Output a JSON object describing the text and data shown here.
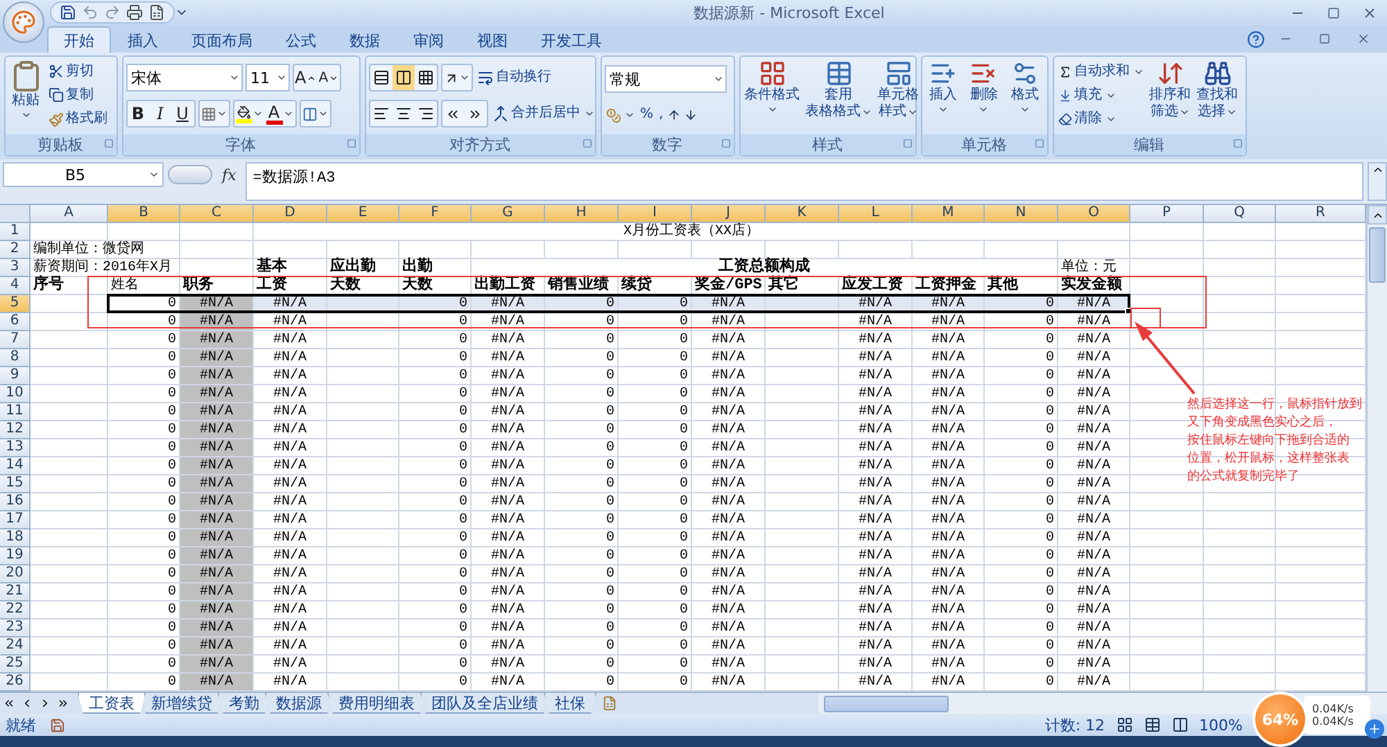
{
  "window": {
    "title": "数据源新 - Microsoft Excel"
  },
  "ribbon_tabs": [
    {
      "label": "开始",
      "selected": true
    },
    {
      "label": "插入",
      "selected": false
    },
    {
      "label": "页面布局",
      "selected": false
    },
    {
      "label": "公式",
      "selected": false
    },
    {
      "label": "数据",
      "selected": false
    },
    {
      "label": "审阅",
      "selected": false
    },
    {
      "label": "视图",
      "selected": false
    },
    {
      "label": "开发工具",
      "selected": false
    }
  ],
  "ribbon": {
    "clipboard": {
      "label": "剪贴板",
      "paste": "粘贴",
      "cut": "剪切",
      "copy": "复制",
      "format_painter": "格式刷"
    },
    "font": {
      "label": "字体",
      "font_name": "宋体",
      "font_size": "11",
      "grow": "A",
      "shrink": "A",
      "bold": "B",
      "italic": "I",
      "underline": "U",
      "font_color": "A"
    },
    "alignment": {
      "label": "对齐方式",
      "vertical": [
        {
          "selected": false
        },
        {
          "selected": true
        },
        {
          "selected": false
        }
      ],
      "wrap_text": "自动换行",
      "merge_center": "合并后居中"
    },
    "number": {
      "label": "数字",
      "format": "常规",
      "percent": "%",
      "comma": ","
    },
    "styles": {
      "label": "样式",
      "buttons": [
        {
          "lines": [
            "条件格式"
          ]
        },
        {
          "lines": [
            "套用",
            "表格格式"
          ]
        },
        {
          "lines": [
            "单元格",
            "样式"
          ]
        }
      ]
    },
    "cells": {
      "label": "单元格",
      "buttons": [
        {
          "lines": [
            "插入"
          ]
        },
        {
          "lines": [
            "删除"
          ]
        },
        {
          "lines": [
            "格式"
          ]
        }
      ]
    },
    "editing": {
      "label": "编辑",
      "autosum": "自动求和",
      "fill": "填充",
      "clear": "清除",
      "sort_filter": [
        "排序和",
        "筛选"
      ],
      "find_select": [
        "查找和",
        "选择"
      ]
    }
  },
  "formula_bar": {
    "name_box": "B5",
    "fx": "fx",
    "formula": "=数据源!A3"
  },
  "columns": [
    {
      "label": "A",
      "selected": false
    },
    {
      "label": "B",
      "selected": true
    },
    {
      "label": "C",
      "selected": true
    },
    {
      "label": "D",
      "selected": true
    },
    {
      "label": "E",
      "selected": true
    },
    {
      "label": "F",
      "selected": true
    },
    {
      "label": "G",
      "selected": true
    },
    {
      "label": "H",
      "selected": true
    },
    {
      "label": "I",
      "selected": true
    },
    {
      "label": "J",
      "selected": true
    },
    {
      "label": "K",
      "selected": true
    },
    {
      "label": "L",
      "selected": true
    },
    {
      "label": "M",
      "selected": true
    },
    {
      "label": "N",
      "selected": true
    },
    {
      "label": "O",
      "selected": true
    },
    {
      "label": "P",
      "selected": false
    },
    {
      "label": "Q",
      "selected": false
    },
    {
      "label": "R",
      "selected": false
    }
  ],
  "rows": [
    {
      "number": "1",
      "selected": false,
      "cells": {
        "D": {
          "text": "X月份工资表（XX店）",
          "kind": "title"
        }
      }
    },
    {
      "number": "2",
      "selected": false,
      "cells": {
        "A": {
          "text": "编制单位：微贷网",
          "kind": "text"
        }
      }
    },
    {
      "number": "3",
      "selected": false,
      "cells": {
        "A": {
          "text": "薪资期间：2016年X月",
          "kind": "text"
        },
        "D": {
          "text": "基本",
          "kind": "heading"
        },
        "E": {
          "text": "应出勤",
          "kind": "heading"
        },
        "F": {
          "text": "出勤",
          "kind": "heading"
        },
        "G": {
          "text": "工资总额构成",
          "kind": "group"
        },
        "O": {
          "text": "单位：元",
          "kind": "text"
        }
      }
    },
    {
      "number": "4",
      "selected": false,
      "cells": {
        "A": {
          "text": "序号",
          "kind": "heading"
        },
        "B": {
          "text": "姓名",
          "kind": "text"
        },
        "C": {
          "text": "职务",
          "kind": "heading"
        },
        "D": {
          "text": "工资",
          "kind": "heading"
        },
        "E": {
          "text": "天数",
          "kind": "heading"
        },
        "F": {
          "text": "天数",
          "kind": "heading"
        },
        "G": {
          "text": "出勤工资",
          "kind": "heading"
        },
        "H": {
          "text": "销售业绩",
          "kind": "heading"
        },
        "I": {
          "text": "续贷",
          "kind": "heading"
        },
        "J": {
          "text": "奖金/GPS",
          "kind": "heading"
        },
        "K": {
          "text": "其它",
          "kind": "heading"
        },
        "L": {
          "text": "应发工资",
          "kind": "heading"
        },
        "M": {
          "text": "工资押金",
          "kind": "heading"
        },
        "N": {
          "text": "其他",
          "kind": "heading"
        },
        "O": {
          "text": "实发金额",
          "kind": "heading"
        }
      }
    },
    {
      "number": "5",
      "selected": true,
      "cells": {
        "B": {
          "text": "0",
          "kind": "number"
        },
        "C": {
          "text": "#N/A",
          "kind": "error",
          "shaded": true
        },
        "D": {
          "text": "#N/A",
          "kind": "error"
        },
        "F": {
          "text": "0",
          "kind": "number"
        },
        "G": {
          "text": "#N/A",
          "kind": "error"
        },
        "H": {
          "text": "0",
          "kind": "number"
        },
        "I": {
          "text": "0",
          "kind": "number"
        },
        "J": {
          "text": "#N/A",
          "kind": "error"
        },
        "L": {
          "text": "#N/A",
          "kind": "error"
        },
        "M": {
          "text": "#N/A",
          "kind": "error"
        },
        "N": {
          "text": "0",
          "kind": "number"
        },
        "O": {
          "text": "#N/A",
          "kind": "error"
        }
      }
    },
    {
      "number": "6",
      "selected": false,
      "cells": {
        "B": {
          "text": "0",
          "kind": "number"
        },
        "C": {
          "text": "#N/A",
          "kind": "error",
          "shaded": true
        },
        "D": {
          "text": "#N/A",
          "kind": "error"
        },
        "F": {
          "text": "0",
          "kind": "number"
        },
        "G": {
          "text": "#N/A",
          "kind": "error"
        },
        "H": {
          "text": "0",
          "kind": "number"
        },
        "I": {
          "text": "0",
          "kind": "number"
        },
        "J": {
          "text": "#N/A",
          "kind": "error"
        },
        "L": {
          "text": "#N/A",
          "kind": "error"
        },
        "M": {
          "text": "#N/A",
          "kind": "error"
        },
        "N": {
          "text": "0",
          "kind": "number"
        },
        "O": {
          "text": "#N/A",
          "kind": "error"
        }
      }
    },
    {
      "number": "7",
      "selected": false,
      "cells": {
        "B": {
          "text": "0",
          "kind": "number"
        },
        "C": {
          "text": "#N/A",
          "kind": "error",
          "shaded": true
        },
        "D": {
          "text": "#N/A",
          "kind": "error"
        },
        "F": {
          "text": "0",
          "kind": "number"
        },
        "G": {
          "text": "#N/A",
          "kind": "error"
        },
        "H": {
          "text": "0",
          "kind": "number"
        },
        "I": {
          "text": "0",
          "kind": "number"
        },
        "J": {
          "text": "#N/A",
          "kind": "error"
        },
        "L": {
          "text": "#N/A",
          "kind": "error"
        },
        "M": {
          "text": "#N/A",
          "kind": "error"
        },
        "N": {
          "text": "0",
          "kind": "number"
        },
        "O": {
          "text": "#N/A",
          "kind": "error"
        }
      }
    },
    {
      "number": "8",
      "selected": false,
      "cells": {
        "B": {
          "text": "0",
          "kind": "number"
        },
        "C": {
          "text": "#N/A",
          "kind": "error",
          "shaded": true
        },
        "D": {
          "text": "#N/A",
          "kind": "error"
        },
        "F": {
          "text": "0",
          "kind": "number"
        },
        "G": {
          "text": "#N/A",
          "kind": "error"
        },
        "H": {
          "text": "0",
          "kind": "number"
        },
        "I": {
          "text": "0",
          "kind": "number"
        },
        "J": {
          "text": "#N/A",
          "kind": "error"
        },
        "L": {
          "text": "#N/A",
          "kind": "error"
        },
        "M": {
          "text": "#N/A",
          "kind": "error"
        },
        "N": {
          "text": "0",
          "kind": "number"
        },
        "O": {
          "text": "#N/A",
          "kind": "error"
        }
      }
    },
    {
      "number": "9",
      "selected": false,
      "cells": {
        "B": {
          "text": "0",
          "kind": "number"
        },
        "C": {
          "text": "#N/A",
          "kind": "error",
          "shaded": true
        },
        "D": {
          "text": "#N/A",
          "kind": "error"
        },
        "F": {
          "text": "0",
          "kind": "number"
        },
        "G": {
          "text": "#N/A",
          "kind": "error"
        },
        "H": {
          "text": "0",
          "kind": "number"
        },
        "I": {
          "text": "0",
          "kind": "number"
        },
        "J": {
          "text": "#N/A",
          "kind": "error"
        },
        "L": {
          "text": "#N/A",
          "kind": "error"
        },
        "M": {
          "text": "#N/A",
          "kind": "error"
        },
        "N": {
          "text": "0",
          "kind": "number"
        },
        "O": {
          "text": "#N/A",
          "kind": "error"
        }
      }
    },
    {
      "number": "10",
      "selected": false,
      "cells": {
        "B": {
          "text": "0",
          "kind": "number"
        },
        "C": {
          "text": "#N/A",
          "kind": "error",
          "shaded": true
        },
        "D": {
          "text": "#N/A",
          "kind": "error"
        },
        "F": {
          "text": "0",
          "kind": "number"
        },
        "G": {
          "text": "#N/A",
          "kind": "error"
        },
        "H": {
          "text": "0",
          "kind": "number"
        },
        "I": {
          "text": "0",
          "kind": "number"
        },
        "J": {
          "text": "#N/A",
          "kind": "error"
        },
        "L": {
          "text": "#N/A",
          "kind": "error"
        },
        "M": {
          "text": "#N/A",
          "kind": "error"
        },
        "N": {
          "text": "0",
          "kind": "number"
        },
        "O": {
          "text": "#N/A",
          "kind": "error"
        }
      }
    },
    {
      "number": "11",
      "selected": false,
      "cells": {
        "B": {
          "text": "0",
          "kind": "number"
        },
        "C": {
          "text": "#N/A",
          "kind": "error",
          "shaded": true
        },
        "D": {
          "text": "#N/A",
          "kind": "error"
        },
        "F": {
          "text": "0",
          "kind": "number"
        },
        "G": {
          "text": "#N/A",
          "kind": "error"
        },
        "H": {
          "text": "0",
          "kind": "number"
        },
        "I": {
          "text": "0",
          "kind": "number"
        },
        "J": {
          "text": "#N/A",
          "kind": "error"
        },
        "L": {
          "text": "#N/A",
          "kind": "error"
        },
        "M": {
          "text": "#N/A",
          "kind": "error"
        },
        "N": {
          "text": "0",
          "kind": "number"
        },
        "O": {
          "text": "#N/A",
          "kind": "error"
        }
      }
    },
    {
      "number": "12",
      "selected": false,
      "cells": {
        "B": {
          "text": "0",
          "kind": "number"
        },
        "C": {
          "text": "#N/A",
          "kind": "error",
          "shaded": true
        },
        "D": {
          "text": "#N/A",
          "kind": "error"
        },
        "F": {
          "text": "0",
          "kind": "number"
        },
        "G": {
          "text": "#N/A",
          "kind": "error"
        },
        "H": {
          "text": "0",
          "kind": "number"
        },
        "I": {
          "text": "0",
          "kind": "number"
        },
        "J": {
          "text": "#N/A",
          "kind": "error"
        },
        "L": {
          "text": "#N/A",
          "kind": "error"
        },
        "M": {
          "text": "#N/A",
          "kind": "error"
        },
        "N": {
          "text": "0",
          "kind": "number"
        },
        "O": {
          "text": "#N/A",
          "kind": "error"
        }
      }
    },
    {
      "number": "13",
      "selected": false,
      "cells": {
        "B": {
          "text": "0",
          "kind": "number"
        },
        "C": {
          "text": "#N/A",
          "kind": "error",
          "shaded": true
        },
        "D": {
          "text": "#N/A",
          "kind": "error"
        },
        "F": {
          "text": "0",
          "kind": "number"
        },
        "G": {
          "text": "#N/A",
          "kind": "error"
        },
        "H": {
          "text": "0",
          "kind": "number"
        },
        "I": {
          "text": "0",
          "kind": "number"
        },
        "J": {
          "text": "#N/A",
          "kind": "error"
        },
        "L": {
          "text": "#N/A",
          "kind": "error"
        },
        "M": {
          "text": "#N/A",
          "kind": "error"
        },
        "N": {
          "text": "0",
          "kind": "number"
        },
        "O": {
          "text": "#N/A",
          "kind": "error"
        }
      }
    },
    {
      "number": "14",
      "selected": false,
      "cells": {
        "B": {
          "text": "0",
          "kind": "number"
        },
        "C": {
          "text": "#N/A",
          "kind": "error",
          "shaded": true
        },
        "D": {
          "text": "#N/A",
          "kind": "error"
        },
        "F": {
          "text": "0",
          "kind": "number"
        },
        "G": {
          "text": "#N/A",
          "kind": "error"
        },
        "H": {
          "text": "0",
          "kind": "number"
        },
        "I": {
          "text": "0",
          "kind": "number"
        },
        "J": {
          "text": "#N/A",
          "kind": "error"
        },
        "L": {
          "text": "#N/A",
          "kind": "error"
        },
        "M": {
          "text": "#N/A",
          "kind": "error"
        },
        "N": {
          "text": "0",
          "kind": "number"
        },
        "O": {
          "text": "#N/A",
          "kind": "error"
        }
      }
    },
    {
      "number": "15",
      "selected": false,
      "cells": {
        "B": {
          "text": "0",
          "kind": "number"
        },
        "C": {
          "text": "#N/A",
          "kind": "error",
          "shaded": true
        },
        "D": {
          "text": "#N/A",
          "kind": "error"
        },
        "F": {
          "text": "0",
          "kind": "number"
        },
        "G": {
          "text": "#N/A",
          "kind": "error"
        },
        "H": {
          "text": "0",
          "kind": "number"
        },
        "I": {
          "text": "0",
          "kind": "number"
        },
        "J": {
          "text": "#N/A",
          "kind": "error"
        },
        "L": {
          "text": "#N/A",
          "kind": "error"
        },
        "M": {
          "text": "#N/A",
          "kind": "error"
        },
        "N": {
          "text": "0",
          "kind": "number"
        },
        "O": {
          "text": "#N/A",
          "kind": "error"
        }
      }
    },
    {
      "number": "16",
      "selected": false,
      "cells": {
        "B": {
          "text": "0",
          "kind": "number"
        },
        "C": {
          "text": "#N/A",
          "kind": "error",
          "shaded": true
        },
        "D": {
          "text": "#N/A",
          "kind": "error"
        },
        "F": {
          "text": "0",
          "kind": "number"
        },
        "G": {
          "text": "#N/A",
          "kind": "error"
        },
        "H": {
          "text": "0",
          "kind": "number"
        },
        "I": {
          "text": "0",
          "kind": "number"
        },
        "J": {
          "text": "#N/A",
          "kind": "error"
        },
        "L": {
          "text": "#N/A",
          "kind": "error"
        },
        "M": {
          "text": "#N/A",
          "kind": "error"
        },
        "N": {
          "text": "0",
          "kind": "number"
        },
        "O": {
          "text": "#N/A",
          "kind": "error"
        }
      }
    },
    {
      "number": "17",
      "selected": false,
      "cells": {
        "B": {
          "text": "0",
          "kind": "number"
        },
        "C": {
          "text": "#N/A",
          "kind": "error",
          "shaded": true
        },
        "D": {
          "text": "#N/A",
          "kind": "error"
        },
        "F": {
          "text": "0",
          "kind": "number"
        },
        "G": {
          "text": "#N/A",
          "kind": "error"
        },
        "H": {
          "text": "0",
          "kind": "number"
        },
        "I": {
          "text": "0",
          "kind": "number"
        },
        "J": {
          "text": "#N/A",
          "kind": "error"
        },
        "L": {
          "text": "#N/A",
          "kind": "error"
        },
        "M": {
          "text": "#N/A",
          "kind": "error"
        },
        "N": {
          "text": "0",
          "kind": "number"
        },
        "O": {
          "text": "#N/A",
          "kind": "error"
        }
      }
    },
    {
      "number": "18",
      "selected": false,
      "cells": {
        "B": {
          "text": "0",
          "kind": "number"
        },
        "C": {
          "text": "#N/A",
          "kind": "error",
          "shaded": true
        },
        "D": {
          "text": "#N/A",
          "kind": "error"
        },
        "F": {
          "text": "0",
          "kind": "number"
        },
        "G": {
          "text": "#N/A",
          "kind": "error"
        },
        "H": {
          "text": "0",
          "kind": "number"
        },
        "I": {
          "text": "0",
          "kind": "number"
        },
        "J": {
          "text": "#N/A",
          "kind": "error"
        },
        "L": {
          "text": "#N/A",
          "kind": "error"
        },
        "M": {
          "text": "#N/A",
          "kind": "error"
        },
        "N": {
          "text": "0",
          "kind": "number"
        },
        "O": {
          "text": "#N/A",
          "kind": "error"
        }
      }
    },
    {
      "number": "19",
      "selected": false,
      "cells": {
        "B": {
          "text": "0",
          "kind": "number"
        },
        "C": {
          "text": "#N/A",
          "kind": "error",
          "shaded": true
        },
        "D": {
          "text": "#N/A",
          "kind": "error"
        },
        "F": {
          "text": "0",
          "kind": "number"
        },
        "G": {
          "text": "#N/A",
          "kind": "error"
        },
        "H": {
          "text": "0",
          "kind": "number"
        },
        "I": {
          "text": "0",
          "kind": "number"
        },
        "J": {
          "text": "#N/A",
          "kind": "error"
        },
        "L": {
          "text": "#N/A",
          "kind": "error"
        },
        "M": {
          "text": "#N/A",
          "kind": "error"
        },
        "N": {
          "text": "0",
          "kind": "number"
        },
        "O": {
          "text": "#N/A",
          "kind": "error"
        }
      }
    },
    {
      "number": "20",
      "selected": false,
      "cells": {
        "B": {
          "text": "0",
          "kind": "number"
        },
        "C": {
          "text": "#N/A",
          "kind": "error",
          "shaded": true
        },
        "D": {
          "text": "#N/A",
          "kind": "error"
        },
        "F": {
          "text": "0",
          "kind": "number"
        },
        "G": {
          "text": "#N/A",
          "kind": "error"
        },
        "H": {
          "text": "0",
          "kind": "number"
        },
        "I": {
          "text": "0",
          "kind": "number"
        },
        "J": {
          "text": "#N/A",
          "kind": "error"
        },
        "L": {
          "text": "#N/A",
          "kind": "error"
        },
        "M": {
          "text": "#N/A",
          "kind": "error"
        },
        "N": {
          "text": "0",
          "kind": "number"
        },
        "O": {
          "text": "#N/A",
          "kind": "error"
        }
      }
    },
    {
      "number": "21",
      "selected": false,
      "cells": {
        "B": {
          "text": "0",
          "kind": "number"
        },
        "C": {
          "text": "#N/A",
          "kind": "error",
          "shaded": true
        },
        "D": {
          "text": "#N/A",
          "kind": "error"
        },
        "F": {
          "text": "0",
          "kind": "number"
        },
        "G": {
          "text": "#N/A",
          "kind": "error"
        },
        "H": {
          "text": "0",
          "kind": "number"
        },
        "I": {
          "text": "0",
          "kind": "number"
        },
        "J": {
          "text": "#N/A",
          "kind": "error"
        },
        "L": {
          "text": "#N/A",
          "kind": "error"
        },
        "M": {
          "text": "#N/A",
          "kind": "error"
        },
        "N": {
          "text": "0",
          "kind": "number"
        },
        "O": {
          "text": "#N/A",
          "kind": "error"
        }
      }
    },
    {
      "number": "22",
      "selected": false,
      "cells": {
        "B": {
          "text": "0",
          "kind": "number"
        },
        "C": {
          "text": "#N/A",
          "kind": "error",
          "shaded": true
        },
        "D": {
          "text": "#N/A",
          "kind": "error"
        },
        "F": {
          "text": "0",
          "kind": "number"
        },
        "G": {
          "text": "#N/A",
          "kind": "error"
        },
        "H": {
          "text": "0",
          "kind": "number"
        },
        "I": {
          "text": "0",
          "kind": "number"
        },
        "J": {
          "text": "#N/A",
          "kind": "error"
        },
        "L": {
          "text": "#N/A",
          "kind": "error"
        },
        "M": {
          "text": "#N/A",
          "kind": "error"
        },
        "N": {
          "text": "0",
          "kind": "number"
        },
        "O": {
          "text": "#N/A",
          "kind": "error"
        }
      }
    },
    {
      "number": "23",
      "selected": false,
      "cells": {
        "B": {
          "text": "0",
          "kind": "number"
        },
        "C": {
          "text": "#N/A",
          "kind": "error",
          "shaded": true
        },
        "D": {
          "text": "#N/A",
          "kind": "error"
        },
        "F": {
          "text": "0",
          "kind": "number"
        },
        "G": {
          "text": "#N/A",
          "kind": "error"
        },
        "H": {
          "text": "0",
          "kind": "number"
        },
        "I": {
          "text": "0",
          "kind": "number"
        },
        "J": {
          "text": "#N/A",
          "kind": "error"
        },
        "L": {
          "text": "#N/A",
          "kind": "error"
        },
        "M": {
          "text": "#N/A",
          "kind": "error"
        },
        "N": {
          "text": "0",
          "kind": "number"
        },
        "O": {
          "text": "#N/A",
          "kind": "error"
        }
      }
    },
    {
      "number": "24",
      "selected": false,
      "cells": {
        "B": {
          "text": "0",
          "kind": "number"
        },
        "C": {
          "text": "#N/A",
          "kind": "error",
          "shaded": true
        },
        "D": {
          "text": "#N/A",
          "kind": "error"
        },
        "F": {
          "text": "0",
          "kind": "number"
        },
        "G": {
          "text": "#N/A",
          "kind": "error"
        },
        "H": {
          "text": "0",
          "kind": "number"
        },
        "I": {
          "text": "0",
          "kind": "number"
        },
        "J": {
          "text": "#N/A",
          "kind": "error"
        },
        "L": {
          "text": "#N/A",
          "kind": "error"
        },
        "M": {
          "text": "#N/A",
          "kind": "error"
        },
        "N": {
          "text": "0",
          "kind": "number"
        },
        "O": {
          "text": "#N/A",
          "kind": "error"
        }
      }
    },
    {
      "number": "25",
      "selected": false,
      "cells": {
        "B": {
          "text": "0",
          "kind": "number"
        },
        "C": {
          "text": "#N/A",
          "kind": "error",
          "shaded": true
        },
        "D": {
          "text": "#N/A",
          "kind": "error"
        },
        "F": {
          "text": "0",
          "kind": "number"
        },
        "G": {
          "text": "#N/A",
          "kind": "error"
        },
        "H": {
          "text": "0",
          "kind": "number"
        },
        "I": {
          "text": "0",
          "kind": "number"
        },
        "J": {
          "text": "#N/A",
          "kind": "error"
        },
        "L": {
          "text": "#N/A",
          "kind": "error"
        },
        "M": {
          "text": "#N/A",
          "kind": "error"
        },
        "N": {
          "text": "0",
          "kind": "number"
        },
        "O": {
          "text": "#N/A",
          "kind": "error"
        }
      }
    },
    {
      "number": "26",
      "selected": false,
      "cells": {
        "B": {
          "text": "0",
          "kind": "number"
        },
        "C": {
          "text": "#N/A",
          "kind": "error",
          "shaded": true
        },
        "D": {
          "text": "#N/A",
          "kind": "error"
        },
        "F": {
          "text": "0",
          "kind": "number"
        },
        "G": {
          "text": "#N/A",
          "kind": "error"
        },
        "H": {
          "text": "0",
          "kind": "number"
        },
        "I": {
          "text": "0",
          "kind": "number"
        },
        "J": {
          "text": "#N/A",
          "kind": "error"
        },
        "L": {
          "text": "#N/A",
          "kind": "error"
        },
        "M": {
          "text": "#N/A",
          "kind": "error"
        },
        "N": {
          "text": "0",
          "kind": "number"
        },
        "O": {
          "text": "#N/A",
          "kind": "error"
        }
      }
    }
  ],
  "annotation": {
    "lines": [
      "然后选择这一行，鼠标指针放到",
      "又下角变成黑色实心之后，",
      "按住鼠标左键向下拖到合适的",
      "位置，松开鼠标，这样整张表",
      "的公式就复制完毕了"
    ]
  },
  "sheet_tabs": [
    {
      "label": "工资表",
      "selected": true
    },
    {
      "label": "新增续贷",
      "selected": false
    },
    {
      "label": "考勤",
      "selected": false
    },
    {
      "label": "数据源",
      "selected": false
    },
    {
      "label": "费用明细表",
      "selected": false
    },
    {
      "label": "团队及全店业绩",
      "selected": false
    },
    {
      "label": "社保",
      "selected": false
    }
  ],
  "status_bar": {
    "mode": "就绪",
    "count": "计数: 12",
    "zoom": "100%"
  },
  "net_widget": {
    "percent": "64%",
    "upload": "0.04K/s",
    "download": "0.04K/s"
  }
}
